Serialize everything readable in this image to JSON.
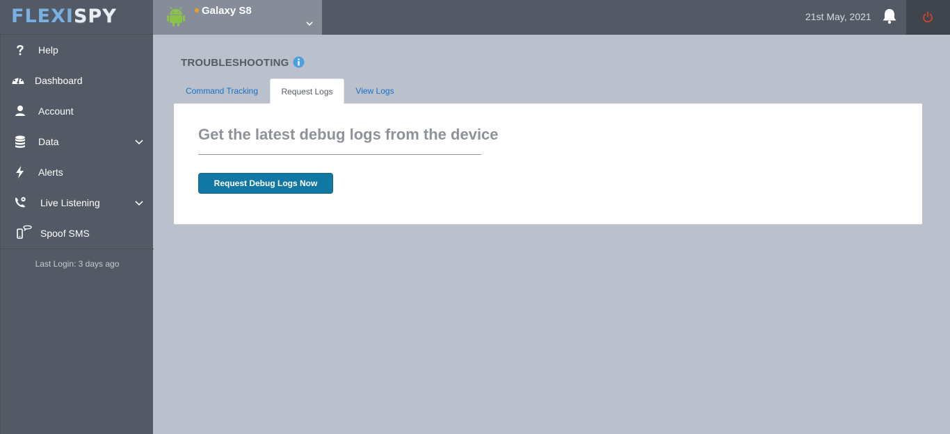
{
  "brand": {
    "logo_part1": "FLEXI",
    "logo_part2": "SPY"
  },
  "device": {
    "name": "Galaxy S8",
    "status_color": "#f0a11a",
    "os_icon": "android-icon"
  },
  "header": {
    "date": "21st May, 2021",
    "bell_icon": "bell-icon",
    "power_icon": "power-icon"
  },
  "sidebar": {
    "items": [
      {
        "label": "Help",
        "icon": "question-icon"
      },
      {
        "label": "Dashboard",
        "icon": "dashboard-icon"
      },
      {
        "label": "Account",
        "icon": "user-icon"
      },
      {
        "label": "Data",
        "icon": "database-icon",
        "expandable": true
      },
      {
        "label": "Alerts",
        "icon": "lightning-icon"
      },
      {
        "label": "Live Listening",
        "icon": "phone-gear-icon",
        "expandable": true
      },
      {
        "label": "Spoof SMS",
        "icon": "phone-chat-icon"
      }
    ],
    "last_login": "Last Login: 3 days ago"
  },
  "main": {
    "title": "TROUBLESHOOTING",
    "tabs": [
      {
        "label": "Command Tracking",
        "active": false
      },
      {
        "label": "Request Logs",
        "active": true
      },
      {
        "label": "View Logs",
        "active": false
      }
    ],
    "panel": {
      "heading": "Get the latest debug logs from the device",
      "button_label": "Request Debug Logs Now"
    }
  },
  "colors": {
    "accent": "#1178a4",
    "link": "#1a6fc6",
    "sidebar": "#545a65",
    "background": "#bac1cc"
  }
}
